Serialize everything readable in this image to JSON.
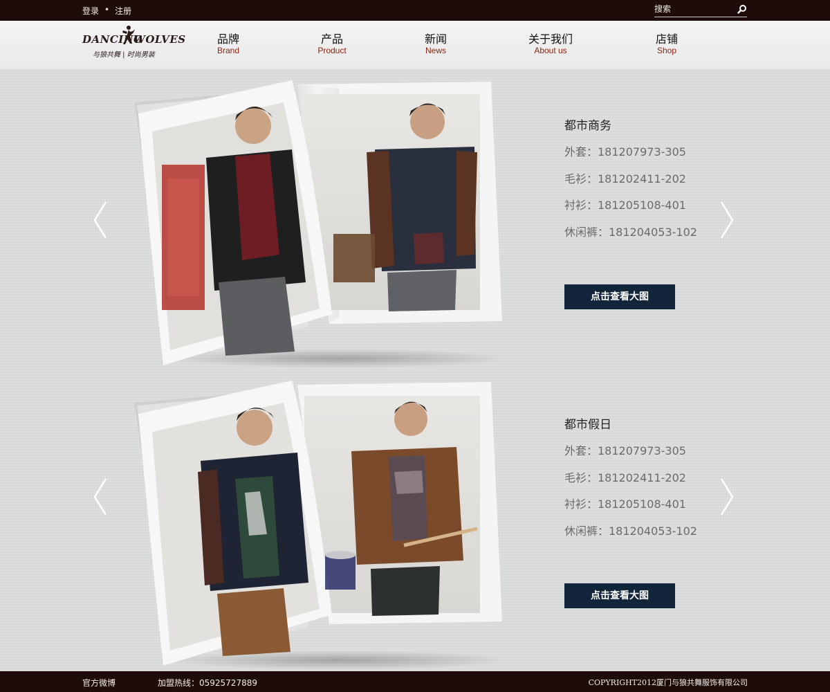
{
  "topbar": {
    "login": "登录",
    "separator": "•",
    "register": "注册",
    "search_placeholder": "搜索"
  },
  "logo": {
    "word_left": "DANCING",
    "word_right": "WOLVES",
    "tagline": "与狼共舞 | 时尚男装"
  },
  "nav": [
    {
      "cn": "品牌",
      "en": "Brand"
    },
    {
      "cn": "产品",
      "en": "Product"
    },
    {
      "cn": "新闻",
      "en": "News"
    },
    {
      "cn": "关于我们",
      "en": "About us"
    },
    {
      "cn": "店铺",
      "en": "Shop"
    }
  ],
  "collections": [
    {
      "title": "都市商务",
      "items": [
        "外套：181207973-305",
        "毛衫：181202411-202",
        "衬衫：181205108-401",
        "休闲裤：181204053-102"
      ],
      "button": "点击查看大图"
    },
    {
      "title": "都市假日",
      "items": [
        "外套：181207973-305",
        "毛衫：181202411-202",
        "衬衫：181205108-401",
        "休闲裤：181204053-102"
      ],
      "button": "点击查看大图"
    }
  ],
  "footer": {
    "weibo": "官方微博",
    "hotline": "加盟热线：05925727889",
    "copyright": "COPYRIGHT2012厦门与狼共舞服饰有限公司"
  },
  "colors": {
    "bar": "#1d0c09",
    "nav_en": "#8a2310",
    "button": "#13253a",
    "page_bg": "#dcdedd"
  },
  "icons": [
    "search-icon",
    "wolf-logo-icon",
    "arrow-left-icon",
    "arrow-right-icon"
  ]
}
